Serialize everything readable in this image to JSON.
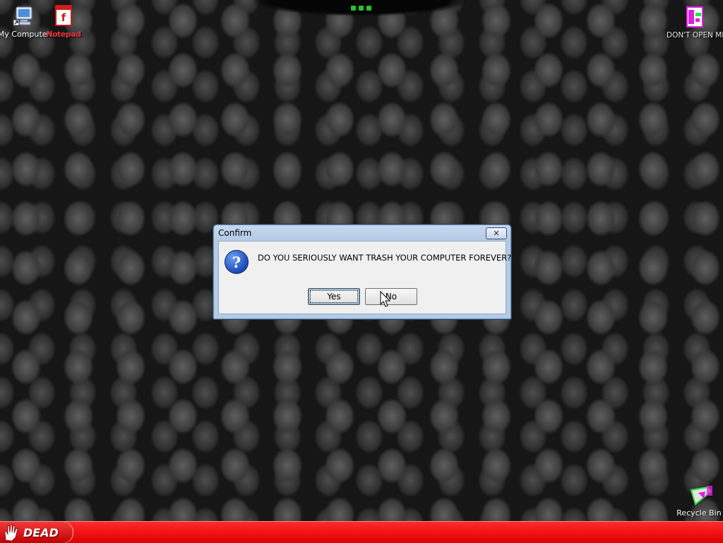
{
  "desktop": {
    "icons": [
      {
        "label": "My Computer",
        "icon": "computer-icon"
      },
      {
        "label": "Notepad",
        "icon": "notepad-icon"
      },
      {
        "label": "DON'T OPEN ME",
        "icon": "glitched-file-icon"
      },
      {
        "label": "Recycle Bin",
        "icon": "recycle-bin-icon"
      }
    ]
  },
  "dialog": {
    "title": "Confirm",
    "close_label": "✕",
    "message": "DO YOU SERIOUSLY WANT TRASH YOUR COMPUTER FOREVER?",
    "icon": "question-icon",
    "yes_label": "Yes",
    "no_label": "No"
  },
  "taskbar": {
    "start_label": "DEAD",
    "start_icon": "hand-icon",
    "color": "#e10000"
  }
}
